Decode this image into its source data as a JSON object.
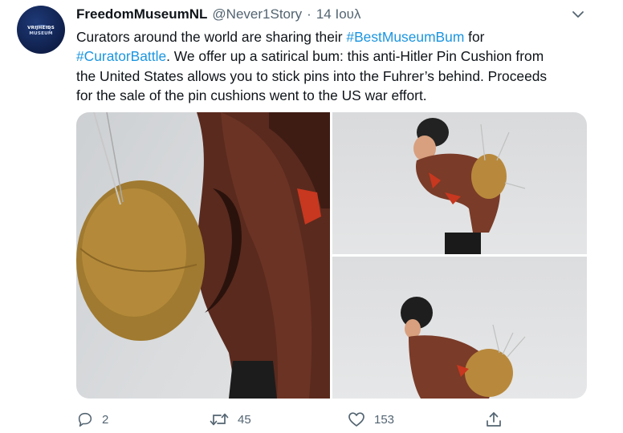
{
  "author": {
    "avatar_line1": "VRIJHEIDS",
    "avatar_line2": "MUSEUM",
    "name": "FreedomMuseumNL",
    "handle": "@Never1Story",
    "separator": "·",
    "date": "14 Ιουλ"
  },
  "tweet": {
    "line1_text": "Curators around the world are sharing their ",
    "line1_tag": "#BestMuseumBum",
    "line1_tail": " for",
    "line2_tag": "#CuratorBattle",
    "line2_text": ". We offer up a satirical bum: this anti-Hitler Pin Cushion from",
    "line3_text": "the United States allows you to stick pins into the Fuhrer’s behind. Proceeds",
    "line4_text": "for the sale of the pin cushions went to the US war effort."
  },
  "actions": {
    "reply_count": "2",
    "retweet_count": "45",
    "like_count": "153"
  },
  "icons": {
    "caret": "chevron-down-icon",
    "reply": "speech-bubble-icon",
    "retweet": "retweet-arrows-icon",
    "like": "heart-icon",
    "share": "share-upload-icon"
  },
  "colors": {
    "text": "#0f1419",
    "muted": "#536471",
    "hashtag": "#1b95e0",
    "avatar_bg": "#0f1f4a"
  }
}
